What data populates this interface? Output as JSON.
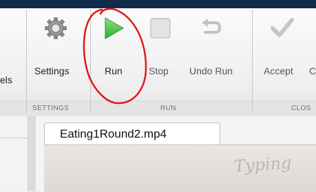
{
  "ribbon": {
    "left_cutoff_label": "els",
    "buttons": {
      "settings": "Settings",
      "run": "Run",
      "stop": "Stop",
      "undo_run": "Undo Run",
      "accept": "Accept",
      "partial": "C"
    },
    "sections": {
      "settings": "SETTINGS",
      "run": "RUN",
      "close": "CLOS"
    }
  },
  "document": {
    "tab_label": "Eating1Round2.mp4",
    "handwriting": "Typing"
  },
  "colors": {
    "run_green": "#3fbf3f",
    "annotation_red": "#e01818",
    "titlebar": "#0e2b4a"
  }
}
